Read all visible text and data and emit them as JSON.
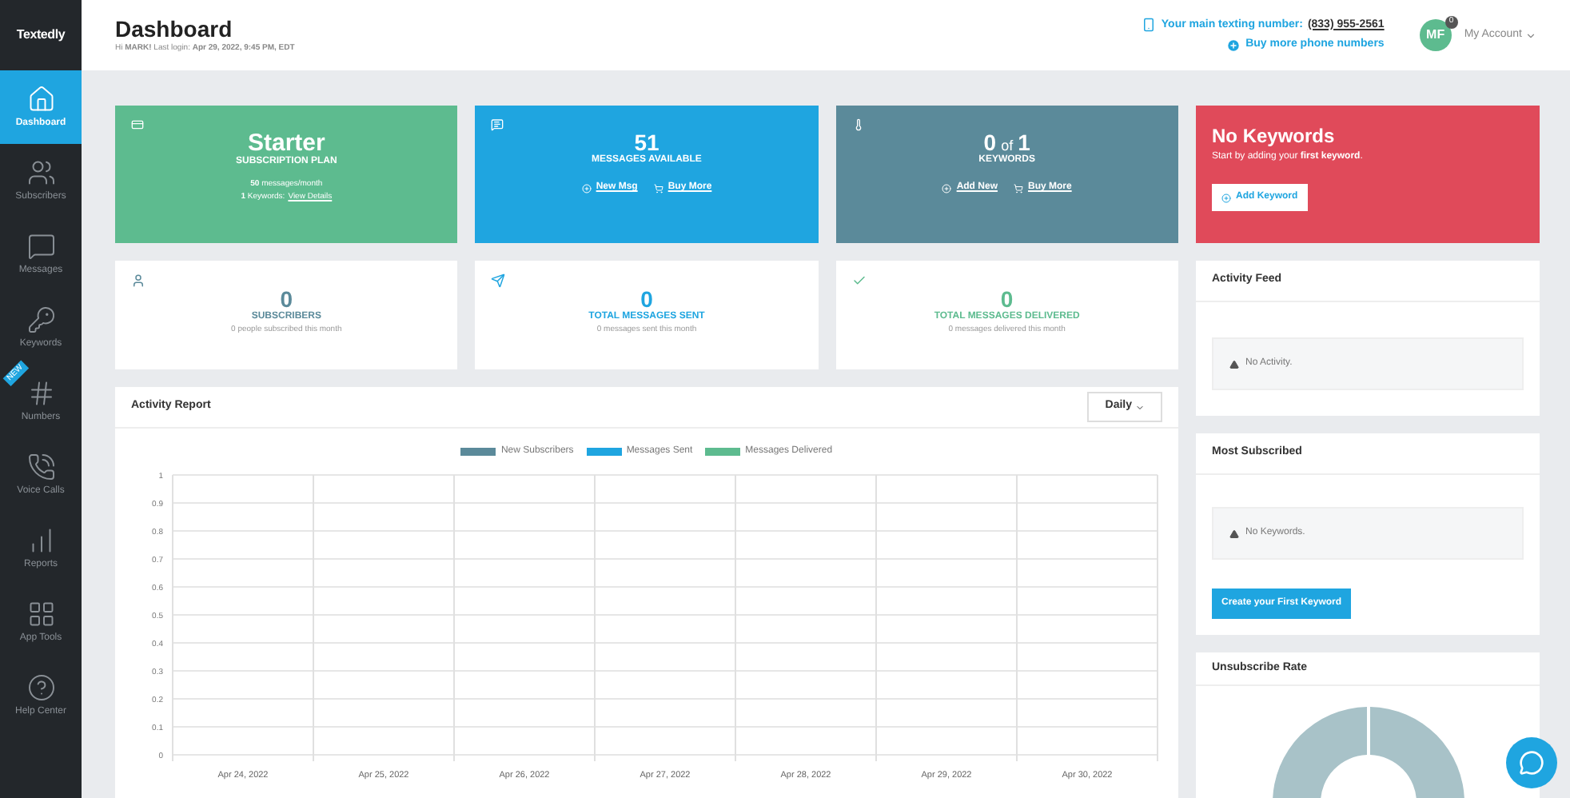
{
  "sidebar": {
    "logo": "Textedly",
    "items": [
      {
        "label": "Dashboard",
        "selected": true
      },
      {
        "label": "Subscribers",
        "selected": false
      },
      {
        "label": "Messages",
        "selected": false
      },
      {
        "label": "Keywords",
        "selected": false
      },
      {
        "label": "Numbers",
        "selected": false,
        "badge": "NEW"
      },
      {
        "label": "Voice Calls",
        "selected": false
      },
      {
        "label": "Reports",
        "selected": false
      },
      {
        "label": "App Tools",
        "selected": false
      },
      {
        "label": "Help Center",
        "selected": false
      }
    ]
  },
  "header": {
    "title": "Dashboard",
    "greeting": "Hi **MARK!** Last login: **Apr 29, 2022, 9:45 PM, EDT**",
    "number_label": "Your main texting number:",
    "number": "(833) 955-2561",
    "buy_link": "Buy more phone numbers",
    "avatar": "MF",
    "avatar_badge": "0",
    "account": "My Account"
  },
  "top_cards": [
    {
      "kind": "plan",
      "color": "#5dbb8f",
      "title": "Starter",
      "label": "SUBSCRIPTION PLAN",
      "line": "**50** messages/month",
      "line2": "**1** Keywords:",
      "link": "View Details"
    },
    {
      "kind": "count",
      "color": "#1fa5e0",
      "value": "51",
      "label": "MESSAGES AVAILABLE",
      "links": [
        "New Msg",
        "Buy More"
      ]
    },
    {
      "kind": "ratio",
      "color": "#5b8a9a",
      "value": "0",
      "of": "of",
      "total": "1",
      "label": "KEYWORDS",
      "links": [
        "Add New",
        "Buy More"
      ]
    },
    {
      "kind": "alert",
      "color": "#e04a5a",
      "title": "No Keywords",
      "text": "Start by adding your **first keyword**.",
      "button": "Add Keyword"
    }
  ],
  "stat_cards": [
    {
      "color": "#5b8a9a",
      "value": "0",
      "label": "SUBSCRIBERS",
      "note": "0 people subscribed this month"
    },
    {
      "color": "#1fa5e0",
      "value": "0",
      "label": "TOTAL MESSAGES SENT",
      "note": "0 messages sent this month"
    },
    {
      "color": "#5dbb8f",
      "value": "0",
      "label": "TOTAL MESSAGES DELIVERED",
      "note": "0 messages delivered this month"
    }
  ],
  "activity_report": {
    "title": "Activity Report",
    "period": "Daily",
    "chart_data": {
      "type": "line",
      "categories": [
        "Apr 24, 2022",
        "Apr 25, 2022",
        "Apr 26, 2022",
        "Apr 27, 2022",
        "Apr 28, 2022",
        "Apr 29, 2022",
        "Apr 30, 2022"
      ],
      "ylim": [
        0,
        1
      ],
      "grid": true,
      "legend": "top",
      "yticks": [
        0,
        0.1,
        0.2,
        0.3,
        0.4,
        0.5,
        0.6,
        0.7,
        0.8,
        0.9,
        1
      ],
      "series": [
        {
          "name": "New Subscribers",
          "color": "#5b8a9a",
          "values": [
            null,
            null,
            null,
            null,
            null,
            null,
            null
          ]
        },
        {
          "name": "Messages Sent",
          "color": "#1fa5e0",
          "values": [
            null,
            null,
            null,
            null,
            null,
            null,
            null
          ]
        },
        {
          "name": "Messages Delivered",
          "color": "#5dbb8f",
          "values": [
            null,
            null,
            null,
            null,
            null,
            null,
            null
          ]
        }
      ]
    }
  },
  "activity_feed": {
    "title": "Activity Feed",
    "empty": "No Activity."
  },
  "most_subscribed": {
    "title": "Most Subscribed",
    "empty": "No Keywords.",
    "button": "Create your First Keyword"
  },
  "unsubscribe_rate": {
    "title": "Unsubscribe Rate"
  }
}
